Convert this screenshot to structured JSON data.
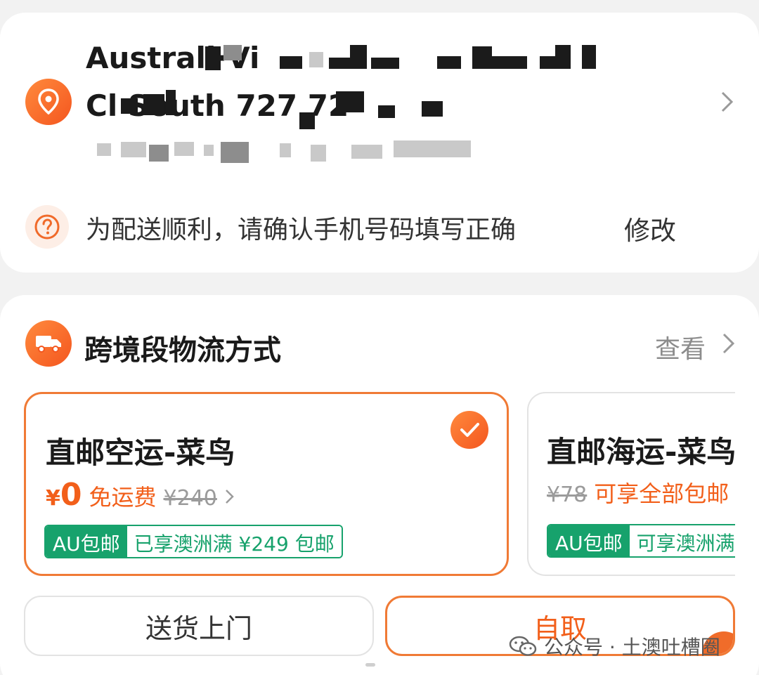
{
  "address": {
    "line1": "Australi·Vi",
    "line2": "Cl   South 727 72",
    "phone": "",
    "tip_text": "为配送顺利，请确认手机号码填写正确",
    "edit_label": "修改"
  },
  "logistics": {
    "section_title": "跨境段物流方式",
    "view_label": "查看",
    "options": [
      {
        "name": "直邮空运-菜鸟",
        "price_symbol": "¥",
        "price_now": "0",
        "free_label": "免运费",
        "price_old": "¥240",
        "badge_main": "AU包邮",
        "badge_sub": "已享澳洲满 ¥249 包邮",
        "selected": true
      },
      {
        "name": "直邮海运-菜鸟",
        "price_old": "¥78",
        "promo": "可享全部包邮",
        "badge_main": "AU包邮",
        "badge_sub": "可享澳洲满",
        "selected": false
      }
    ]
  },
  "delivery_modes": {
    "home_delivery": "送货上门",
    "pickup": "自取"
  },
  "watermark": "公众号 · 土澳吐槽圈",
  "colors": {
    "accent": "#f25f1a",
    "badge_green": "#17a26c",
    "background": "#f2f2f2"
  }
}
